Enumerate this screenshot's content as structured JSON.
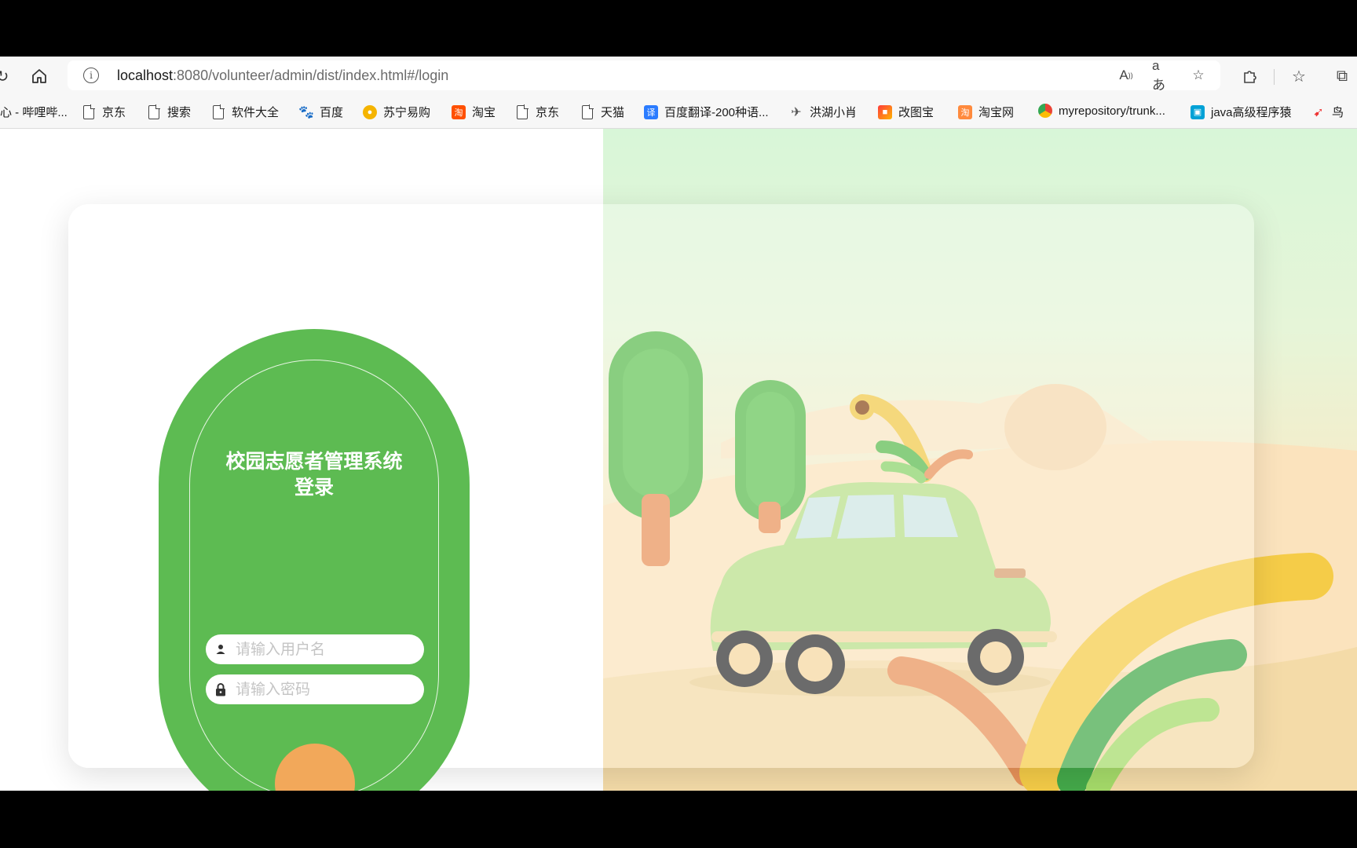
{
  "browser": {
    "url_host": "localhost",
    "url_rest": ":8080/volunteer/admin/dist/index.html#/login",
    "bookmarks": [
      {
        "label": "心 - 哔哩哔...",
        "icon": "none"
      },
      {
        "label": "京东",
        "icon": "page-icon"
      },
      {
        "label": "搜索",
        "icon": "page-icon"
      },
      {
        "label": "软件大全",
        "icon": "page-icon"
      },
      {
        "label": "百度",
        "icon": "baidu-paw-icon"
      },
      {
        "label": "苏宁易购",
        "icon": "suning-lion-icon"
      },
      {
        "label": "淘宝",
        "icon": "taobao-icon"
      },
      {
        "label": "京东",
        "icon": "page-icon"
      },
      {
        "label": "天猫",
        "icon": "page-icon"
      },
      {
        "label": "百度翻译-200种语...",
        "icon": "baidu-translate-icon"
      },
      {
        "label": "洪湖小肖",
        "icon": "eagle-icon"
      },
      {
        "label": "改图宝",
        "icon": "gaitubao-icon"
      },
      {
        "label": "淘宝网",
        "icon": "taobao-icon"
      },
      {
        "label": "myrepository/trunk...",
        "icon": "chrome-icon"
      },
      {
        "label": "java高级程序猿",
        "icon": "bilibili-icon"
      },
      {
        "label": "鸟",
        "icon": "bird-icon"
      }
    ]
  },
  "login": {
    "title": "校园志愿者管理系统登录",
    "username_placeholder": "请输入用户名",
    "password_placeholder": "请输入密码"
  },
  "colors": {
    "pill_green": "#5dbb52",
    "accent_orange": "#f2a85a"
  }
}
